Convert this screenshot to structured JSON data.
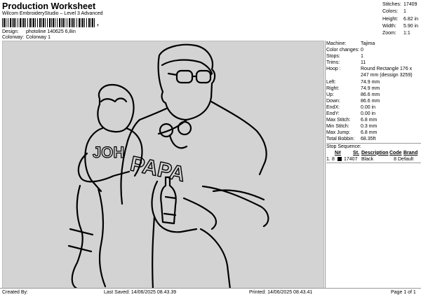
{
  "header": {
    "title": "Production Worksheet",
    "subtitle": "Wilcom EmbroideryStudio – Level 3 Advanced",
    "barcode_suffix": ",",
    "design_label": "Design:",
    "design_value": "photoline 140625 6,8in",
    "colorway_label": "Colorway:",
    "colorway_value": "Colorway 1"
  },
  "stats": [
    {
      "label": "Stitches:",
      "value": "17409"
    },
    {
      "label": "Colors:",
      "value": "1"
    },
    {
      "label": "Height:",
      "value": "6.82 in"
    },
    {
      "label": "Width:",
      "value": "5.90 in"
    },
    {
      "label": "Zoom:",
      "value": "1:1"
    }
  ],
  "machine_info": [
    {
      "label": "Machine:",
      "value": "Tajima"
    },
    {
      "label": "Color changes:",
      "value": "0"
    },
    {
      "label": "Stops:",
      "value": "1"
    },
    {
      "label": "Trims:",
      "value": "11"
    },
    {
      "label": "Hoop :",
      "value": "Round Rectangle 176 x 247 mm (dessign 3259)"
    },
    {
      "label": "Left:",
      "value": "74.9 mm"
    },
    {
      "label": "Right:",
      "value": "74.9 mm"
    },
    {
      "label": "Up:",
      "value": "86.6 mm"
    },
    {
      "label": "Down:",
      "value": "86.6 mm"
    },
    {
      "label": "EndX:",
      "value": "0.00 in"
    },
    {
      "label": "EndY:",
      "value": "0.00 in"
    },
    {
      "label": "Max Stitch:",
      "value": "6.8 mm"
    },
    {
      "label": "Min Stitch:",
      "value": "0.3 mm"
    },
    {
      "label": "Max Jump:",
      "value": "6.8 mm"
    },
    {
      "label": "Total Bobbin:",
      "value": "68.35ft"
    }
  ],
  "stop_sequence": {
    "title": "Stop Sequence:",
    "columns": [
      "N#",
      "St.",
      "Description",
      "Code",
      "Brand"
    ],
    "rows": [
      {
        "n": "1.",
        "num": "8",
        "stitches": "17407",
        "description": "Black",
        "code": "8",
        "brand": "Default",
        "color": "#000000"
      }
    ]
  },
  "artwork": {
    "shirt_text": "PAPA",
    "child_text": "JOH"
  },
  "footer": {
    "created_by": "Created By:",
    "last_saved": "Last Saved: 14/06/2025 08.43.39",
    "printed": "Printed: 14/06/2025 08.43.41",
    "page": "Page 1 of 1"
  }
}
